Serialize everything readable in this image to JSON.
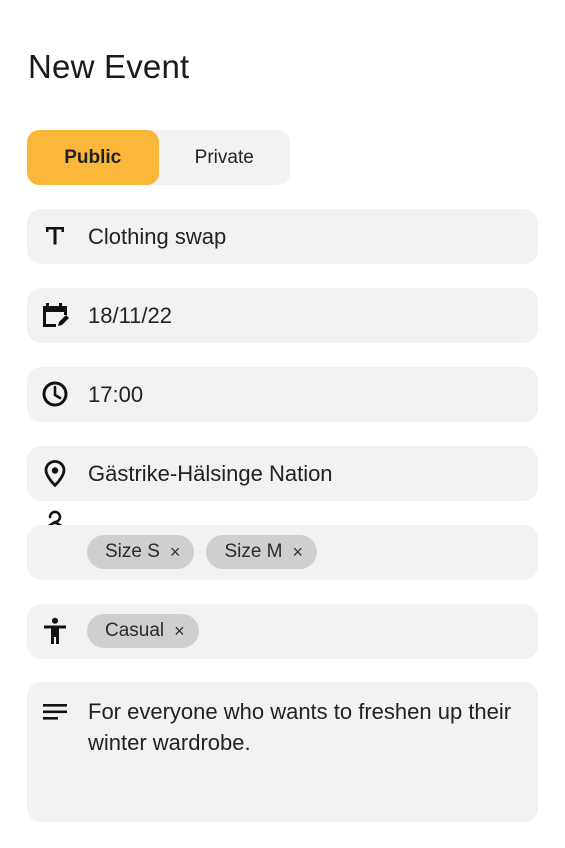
{
  "title": "New Event",
  "visibility": {
    "options": [
      "Public",
      "Private"
    ],
    "selected": "Public"
  },
  "fields": {
    "name": {
      "icon": "text-icon",
      "value": "Clothing swap"
    },
    "date": {
      "icon": "calendar-edit-icon",
      "value": "18/11/22"
    },
    "time": {
      "icon": "clock-icon",
      "value": "17:00"
    },
    "location": {
      "icon": "location-pin-icon",
      "value": "Gästrike-Hälsinge Nation"
    },
    "sizes": {
      "icon": "hanger-icon",
      "tags": [
        "Size S",
        "Size M"
      ]
    },
    "dress_code": {
      "icon": "person-icon",
      "tags": [
        "Casual"
      ]
    },
    "description": {
      "icon": "notes-icon",
      "value": "For everyone who wants to freshen up their winter wardrobe."
    }
  },
  "chip_remove_symbol": "×",
  "colors": {
    "accent": "#fbb73a",
    "field_bg": "#f2f2f2",
    "chip_bg": "#cfcfcf"
  }
}
